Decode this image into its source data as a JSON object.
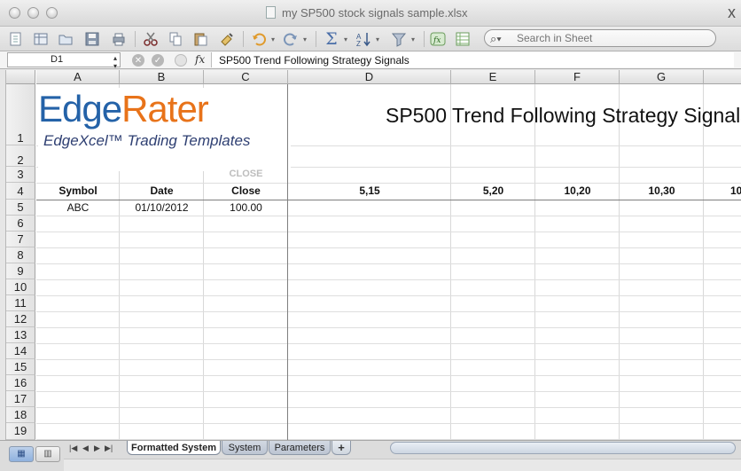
{
  "window": {
    "title": "my SP500 stock signals sample.xlsx",
    "close_glyph": "x"
  },
  "toolbar": {
    "search_placeholder": "Search in Sheet",
    "icons": [
      "new-icon",
      "templates-icon",
      "open-icon",
      "save-icon",
      "print-icon",
      "cut-icon",
      "copy-icon",
      "paste-icon",
      "format-painter-icon",
      "undo-icon",
      "redo-icon",
      "autosum-icon",
      "sort-icon",
      "filter-icon",
      "function-icon",
      "gallery-icon",
      "search-icon"
    ]
  },
  "formula_bar": {
    "cell_ref": "D1",
    "fx_label": "fx",
    "formula": "SP500 Trend Following Strategy Signals"
  },
  "grid": {
    "columns": [
      "A",
      "B",
      "C",
      "D",
      "E",
      "F",
      "G",
      ""
    ],
    "rows": [
      "1",
      "2",
      "3",
      "4",
      "5",
      "6",
      "7",
      "8",
      "9",
      "10",
      "11",
      "12",
      "13",
      "14",
      "15",
      "16",
      "17",
      "18",
      "19"
    ],
    "logo_text_a": "Edge",
    "logo_text_b": "Rater",
    "logo_subtitle": "EdgeXcel™ Trading Templates",
    "title": "SP500 Trend Following Strategy Signals",
    "row3": {
      "C": "CLOSE"
    },
    "row4": {
      "A": "Symbol",
      "B": "Date",
      "C": "Close",
      "D": "5,15",
      "E": "5,20",
      "F": "10,20",
      "G": "10,30",
      "H": "10"
    },
    "row5": {
      "A": "ABC",
      "B": "01/10/2012",
      "C": "100.00"
    }
  },
  "sheets": {
    "tabs": [
      "Formatted System",
      "System",
      "Parameters"
    ],
    "active": "Formatted System",
    "add_label": "+"
  }
}
